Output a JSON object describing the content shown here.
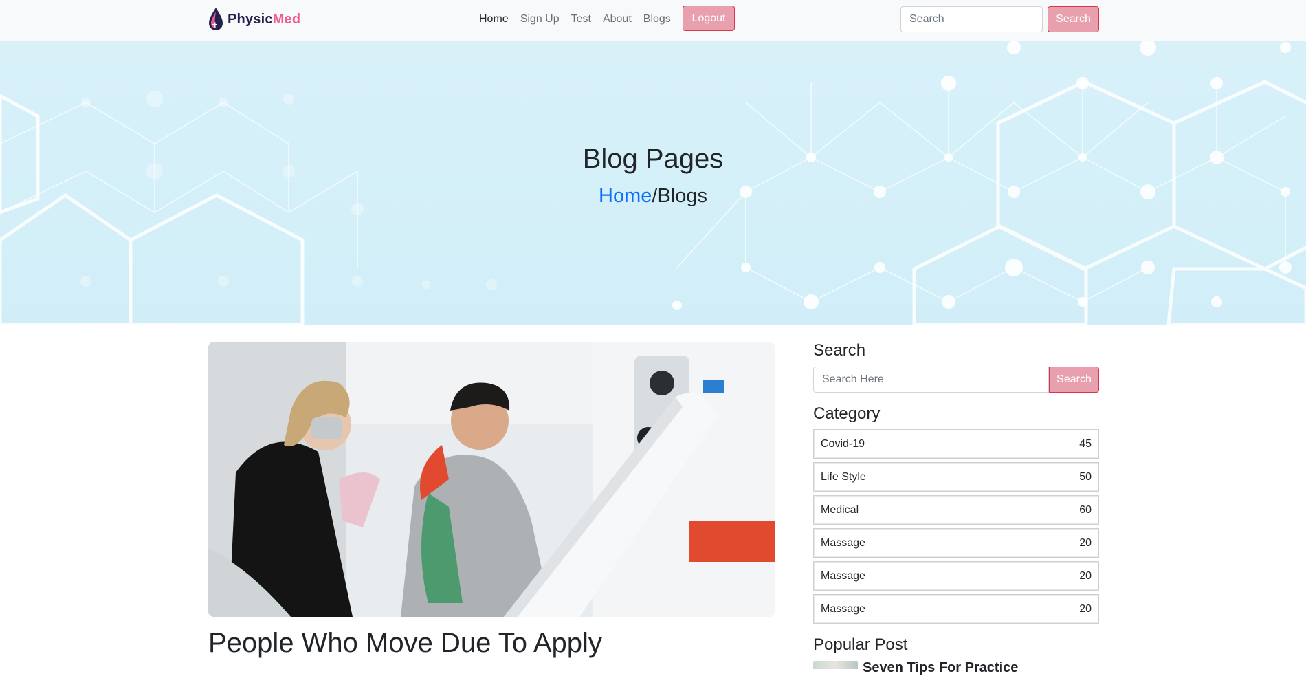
{
  "brand": {
    "part1": "Physic",
    "part2": "Med"
  },
  "nav": {
    "links": [
      "Home",
      "Sign Up",
      "Test",
      "About",
      "Blogs"
    ],
    "logout_label": "Logout",
    "search_placeholder": "Search",
    "search_button": "Search"
  },
  "hero": {
    "title": "Blog Pages",
    "breadcrumb_home": "Home",
    "breadcrumb_separator": "/",
    "breadcrumb_current": "Blogs"
  },
  "post": {
    "title": "People Who Move Due To Apply"
  },
  "sidebar": {
    "search_heading": "Search",
    "search_placeholder": "Search Here",
    "search_button": "Search",
    "category_heading": "Category",
    "categories": [
      {
        "name": "Covid-19",
        "count": "45"
      },
      {
        "name": "Life Style",
        "count": "50"
      },
      {
        "name": "Medical",
        "count": "60"
      },
      {
        "name": "Massage",
        "count": "20"
      },
      {
        "name": "Massage",
        "count": "20"
      },
      {
        "name": "Massage",
        "count": "20"
      }
    ],
    "popular_heading": "Popular Post",
    "popular_first_title": "Seven Tips For Practice"
  },
  "colors": {
    "accent_pink": "#e9a0ae",
    "accent_border": "#dc3545",
    "link_blue": "#0d6efd",
    "hero_bg": "#d8f1f9",
    "brand_dark": "#23214f",
    "brand_pink": "#ee5a91"
  }
}
